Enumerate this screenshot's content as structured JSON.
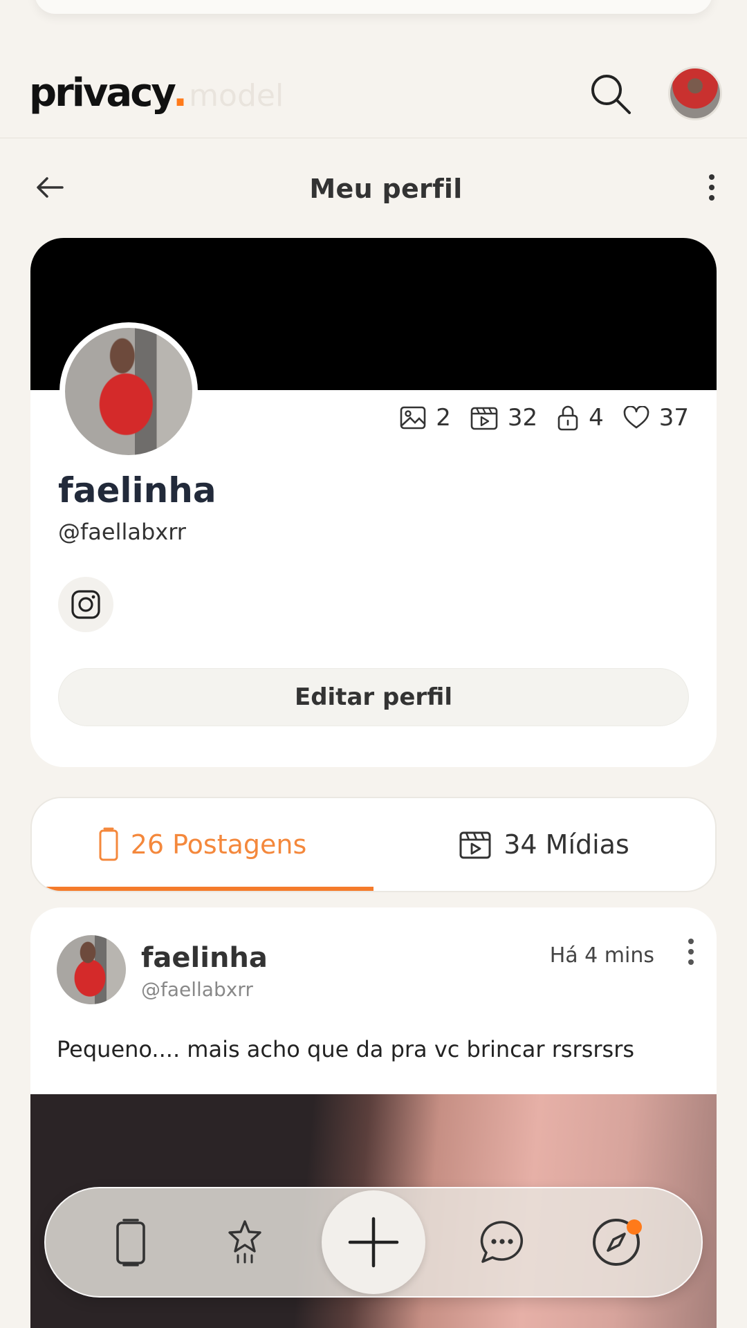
{
  "header": {
    "logo_text": "privacy",
    "logo_dot": ".",
    "logo_suffix": "model",
    "icons": [
      "search-icon",
      "avatar"
    ]
  },
  "page": {
    "title": "Meu perfil",
    "icons": [
      "back-arrow-icon",
      "more-vertical-icon"
    ]
  },
  "profile": {
    "name": "faelinha",
    "handle": "@faellabxrr",
    "stats": {
      "images": "2",
      "videos": "32",
      "locked": "4",
      "likes": "37"
    },
    "edit_label": "Editar perfil",
    "social_icon": "instagram-icon"
  },
  "tabs": [
    {
      "label": "26 Postagens",
      "icon": "phone-icon",
      "active": true
    },
    {
      "label": "34 Mídias",
      "icon": "video-clapper-icon",
      "active": false
    }
  ],
  "post": {
    "author": "faelinha",
    "handle": "@faellabxrr",
    "time": "Há 4 mins",
    "text": "Pequeno.... mais acho que da pra vc brincar rsrsrsrs"
  },
  "bottom_nav": {
    "items": [
      "feed-icon",
      "star-icon",
      "plus-icon",
      "chat-icon",
      "compass-icon"
    ],
    "accent": "#ff7a1a"
  },
  "colors": {
    "accent": "#f47b2b",
    "background": "#f6f3ee"
  }
}
